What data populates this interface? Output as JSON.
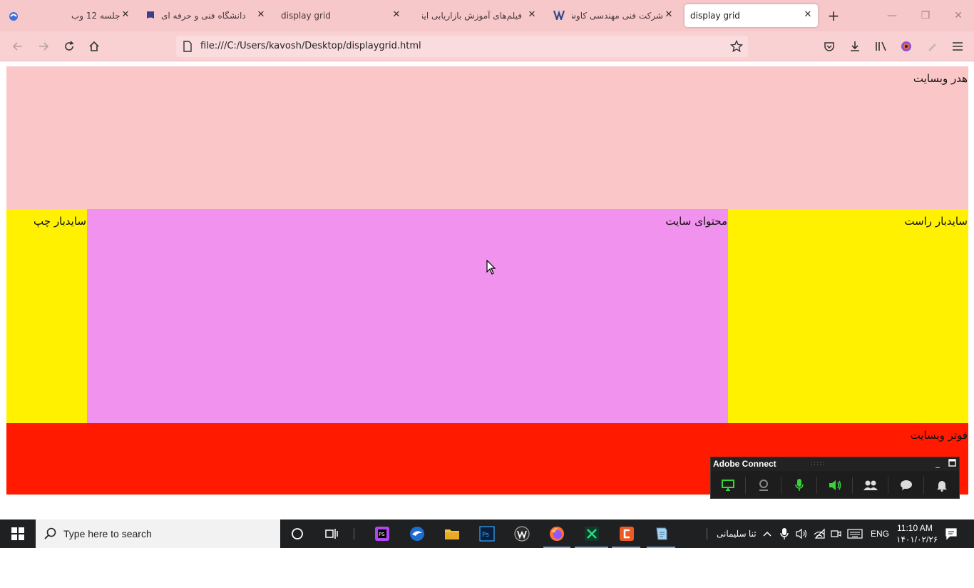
{
  "browser": {
    "tabs": [
      {
        "title": "جلسه 12 وب",
        "active": false
      },
      {
        "title": "دانشگاه فنی و حرفه ای",
        "active": false
      },
      {
        "title": "display grid",
        "active": false
      },
      {
        "title": "فیلم‌های آموزش بازاریابی اینتر",
        "active": false
      },
      {
        "title": "شرکت فنی مهندسی کاوش",
        "active": false
      },
      {
        "title": "display grid",
        "active": true
      }
    ],
    "url": "file:///C:/Users/kavosh/Desktop/displaygrid.html"
  },
  "page": {
    "header": "هدر وبسایت",
    "sidebar_right": "سایدبار راست",
    "content": "محتوای سایت",
    "sidebar_left": "سایدبار چپ",
    "footer": "فوتر وبسایت",
    "colors": {
      "header": "#fbc6c7",
      "sidebar": "#fff100",
      "content": "#f292ef",
      "footer": "#ff1a00"
    }
  },
  "adobe_connect": {
    "title": "Adobe Connect"
  },
  "taskbar": {
    "search_placeholder": "Type here to search",
    "user": "ثنا سلیمانی",
    "language": "ENG",
    "time": "11:10 AM",
    "date": "۱۴۰۱/۰۲/۲۶"
  }
}
